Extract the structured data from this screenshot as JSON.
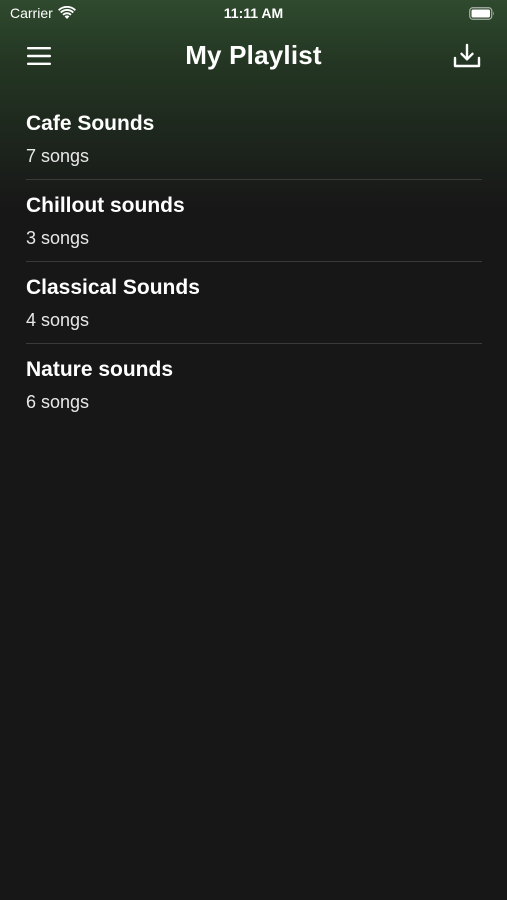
{
  "status_bar": {
    "carrier": "Carrier",
    "time": "11:11 AM",
    "wifi_icon": "wifi-icon",
    "battery_icon": "battery-icon"
  },
  "nav": {
    "title": "My Playlist",
    "left_icon": "hamburger-menu-icon",
    "right_icon": "download-icon"
  },
  "playlists": [
    {
      "name": "Cafe Sounds",
      "count": "7 songs"
    },
    {
      "name": "Chillout sounds",
      "count": "3 songs"
    },
    {
      "name": "Classical Sounds",
      "count": "4 songs"
    },
    {
      "name": "Nature sounds",
      "count": "6 songs"
    }
  ],
  "colors": {
    "background": "#171717",
    "header_gradient_top": "#2f4a2e",
    "divider": "#3a3a3a",
    "text_primary": "#ffffff"
  }
}
